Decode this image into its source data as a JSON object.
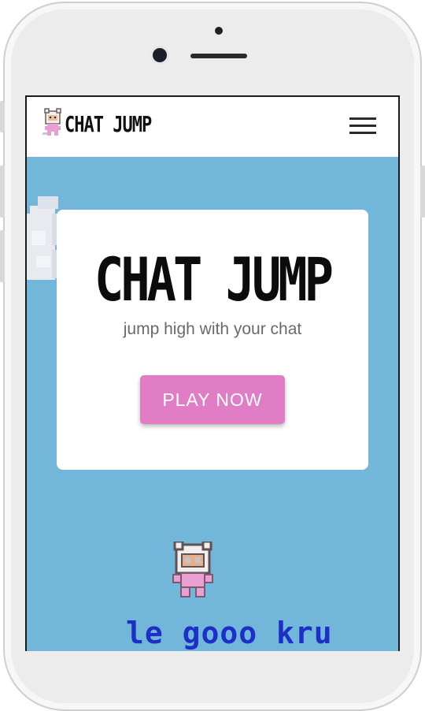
{
  "navbar": {
    "brand_name": "CHAT JUMP",
    "menu_icon": "hamburger-menu-icon"
  },
  "hero": {
    "title": "CHAT JUMP",
    "subtitle": "jump high with your chat",
    "play_button_label": "PLAY NOW"
  },
  "game": {
    "chat_message": "le gooo kru",
    "character_icon": "pixel-astronaut-character-icon",
    "cloud_icon": "pixel-cloud-icon"
  },
  "colors": {
    "sky": "#72b6da",
    "button": "#e07dc4",
    "chat_text": "#1c30c8",
    "card": "#ffffff"
  }
}
